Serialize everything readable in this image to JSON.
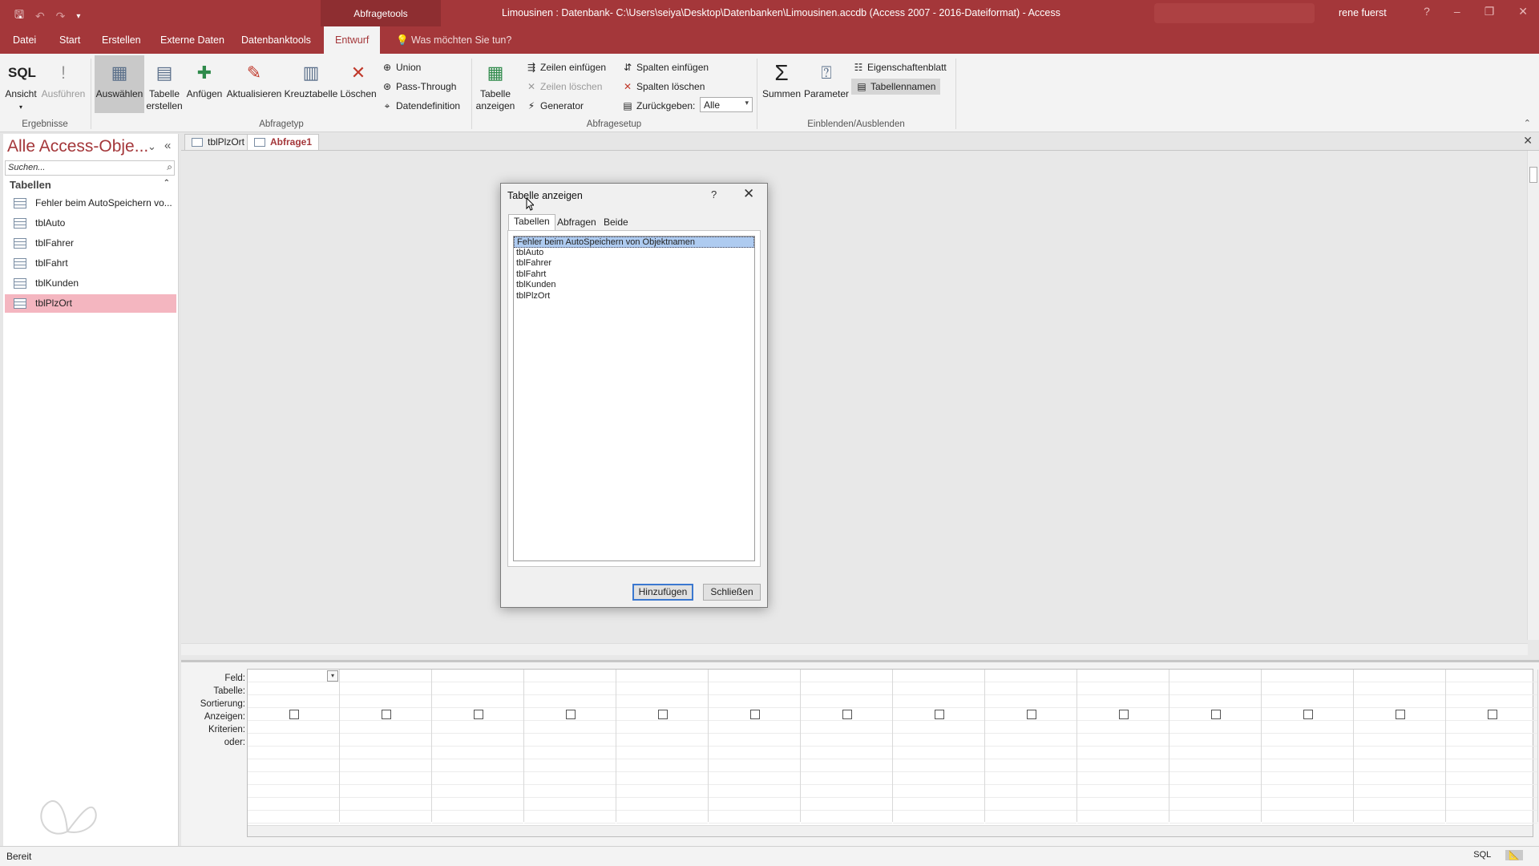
{
  "titlebar": {
    "context_tab": "Abfragetools",
    "window_title": "Limousinen : Datenbank- C:\\Users\\seiya\\Desktop\\Datenbanken\\Limousinen.accdb (Access 2007 - 2016-Dateiformat)  -  Access",
    "user": "rene fuerst",
    "help": "?",
    "minimize": "–",
    "restore": "❐",
    "close": "✕"
  },
  "tabs": {
    "items": [
      "Datei",
      "Start",
      "Erstellen",
      "Externe Daten",
      "Datenbanktools",
      "Entwurf"
    ],
    "active": "Entwurf",
    "tell_me": "Was möchten Sie tun?"
  },
  "ribbon": {
    "results": {
      "label": "Ergebnisse",
      "view": "Ansicht",
      "run": "Ausführen"
    },
    "query_type": {
      "label": "Abfragetyp",
      "select": "Auswählen",
      "make_table_1": "Tabelle",
      "make_table_2": "erstellen",
      "append": "Anfügen",
      "update": "Aktualisieren",
      "crosstab": "Kreuztabelle",
      "delete": "Löschen",
      "union": "Union",
      "pass_through": "Pass-Through",
      "data_definition": "Datendefinition"
    },
    "query_setup": {
      "label": "Abfragesetup",
      "show_table_1": "Tabelle",
      "show_table_2": "anzeigen",
      "insert_rows": "Zeilen einfügen",
      "delete_rows": "Zeilen löschen",
      "builder": "Generator",
      "insert_columns": "Spalten einfügen",
      "delete_columns": "Spalten löschen",
      "return_label": "Zurückgeben:",
      "return_value": "Alle"
    },
    "show_hide": {
      "label": "Einblenden/Ausblenden",
      "totals": "Summen",
      "parameters": "Parameter",
      "property_sheet": "Eigenschaftenblatt",
      "table_names": "Tabellennamen"
    }
  },
  "nav": {
    "title": "Alle Access-Obje...",
    "search_placeholder": "Suchen...",
    "group": "Tabellen",
    "items": [
      "Fehler beim AutoSpeichern vo...",
      "tblAuto",
      "tblFahrer",
      "tblFahrt",
      "tblKunden",
      "tblPlzOrt"
    ],
    "selected": "tblPlzOrt"
  },
  "doc_tabs": [
    "tblPlzOrt",
    "Abfrage1"
  ],
  "qbe": {
    "row_labels": [
      "Feld:",
      "Tabelle:",
      "Sortierung:",
      "Anzeigen:",
      "Kriterien:",
      "oder:"
    ]
  },
  "status": {
    "text": "Bereit",
    "sql": "SQL"
  },
  "dialog": {
    "title": "Tabelle anzeigen",
    "tabs": [
      "Tabellen",
      "Abfragen",
      "Beide"
    ],
    "active_tab": "Tabellen",
    "list": [
      "Fehler beim AutoSpeichern von Objektnamen",
      "tblAuto",
      "tblFahrer",
      "tblFahrt",
      "tblKunden",
      "tblPlzOrt"
    ],
    "selected": "Fehler beim AutoSpeichern von Objektnamen",
    "add_button": "Hinzufügen",
    "close_button": "Schließen"
  },
  "colors": {
    "accent": "#a4373a",
    "nav_selected": "#f4b6c0",
    "list_selected": "#aecbf0"
  }
}
